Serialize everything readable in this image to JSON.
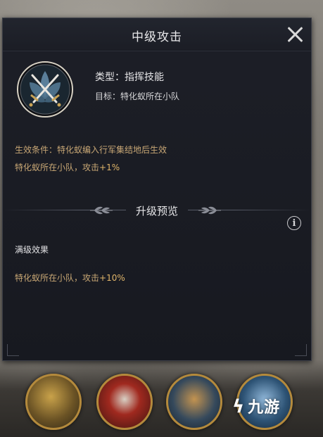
{
  "dialog": {
    "title": "中级攻击",
    "skill": {
      "type_text": "类型：指挥技能",
      "target_text": "目标：特化蚁所在小队"
    },
    "condition_line": "生效条件：特化蚁编入行军集结地后生效",
    "effect_line": {
      "prefix": "特化蚁所在小队，攻击",
      "value": "+1%"
    },
    "upgrade_section_title": "升级预览",
    "info_glyph": "i",
    "max_level_title": "满级效果",
    "max_effect_line": {
      "prefix": "特化蚁所在小队，攻击",
      "value": "+10%"
    }
  },
  "watermark": {
    "mark": "ϟ",
    "text": "九游"
  },
  "icons": [
    "close-icon",
    "crossed-swords-icon",
    "leaf-ornament-icon",
    "info-icon"
  ],
  "colors": {
    "panel_bg": "#1b1d25",
    "title_text": "#e8e8ea",
    "effect_text": "#c8a775",
    "highlight": "#e0b56a",
    "icon_frame": "#d8d2c4"
  }
}
